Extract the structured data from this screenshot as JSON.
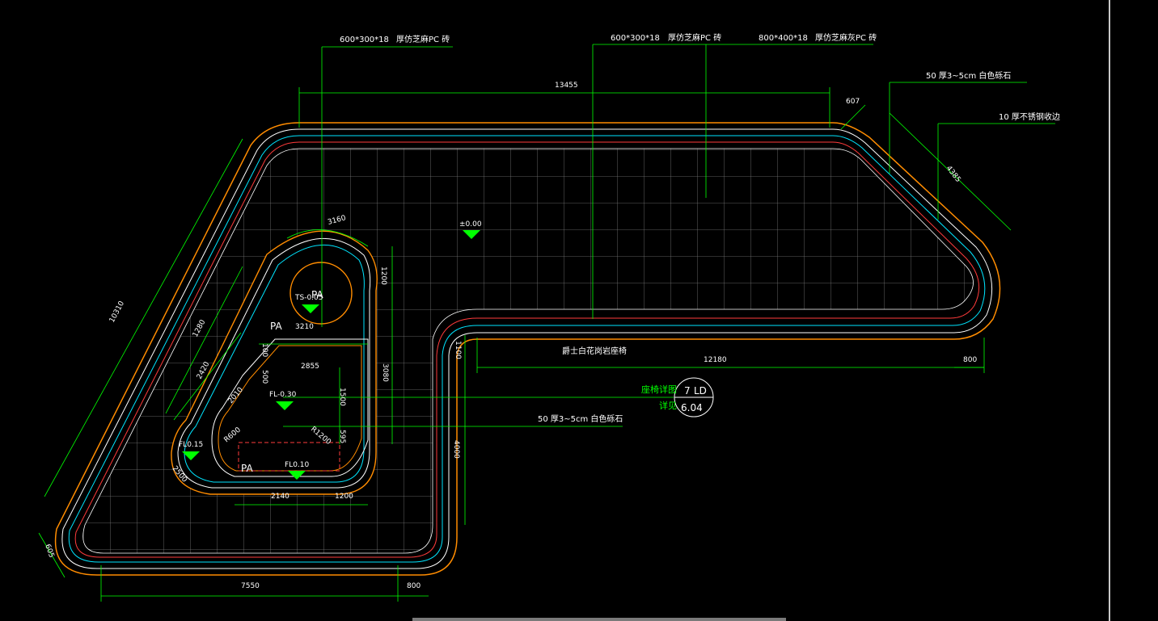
{
  "drawing": {
    "dims": {
      "top_overall": "13455",
      "left_diag": "10310",
      "bottom_left": "7550",
      "bottom_right": "800",
      "right_bottom": "12180",
      "right_bottom_small": "800",
      "right_diag": "4385",
      "right_corner": "607",
      "left_corner": "605",
      "bench_top": "3210",
      "inner_width": "2855",
      "bottom_inner": "2140",
      "bottom_inner_r": "1200",
      "vert_1200": "1200",
      "vert_3080": "3080",
      "vert_4000": "4000",
      "vert_1100": "1100",
      "arc_3160": "3160",
      "diag_1280": "1280",
      "diag_2420": "2420",
      "diag_2010": "2010",
      "r_600": "R600",
      "r_1200": "R1200",
      "d_2500": "2500",
      "d_100": "100",
      "d_500": "500",
      "d_1500": "1500",
      "d_595": "595"
    },
    "notes": {
      "tile1_size": "600*300*18",
      "tile1_desc": "厚仿芝麻PC 砖",
      "tile2_size": "600*300*18",
      "tile2_desc": "厚仿芝麻PC 砖",
      "tile3_size": "800*400*18",
      "tile3_desc": "厚仿芝麻灰PC 砖",
      "pebble_top": "50  厚3~5cm   白色砾石",
      "steel_edge": "10  厚不锈钢收边",
      "bench": "爵士白花岗岩座椅",
      "pebble_mid": "50  厚3~5cm     白色砾石",
      "detail_title": "座椅详图",
      "detail_ref": "详见",
      "detail_no": "7",
      "detail_code": "LD",
      "detail_sheet": "6.04"
    },
    "levels": {
      "main": "±0.00",
      "ts": "TS-0.05",
      "fl_mid": "FL-0.30",
      "fl_left": "FL0.15",
      "fl_bottom": "FL0.10"
    },
    "labels": {
      "pa1": "PA",
      "pa2": "PA",
      "pa3": "PA"
    }
  }
}
